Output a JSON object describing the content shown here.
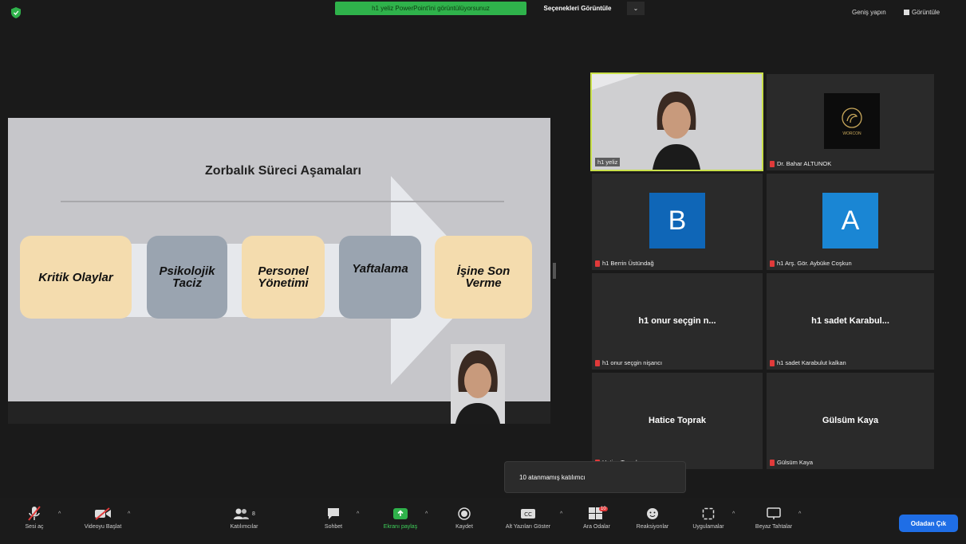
{
  "top_bar": {
    "share_banner": "h1 yeliz PowerPoint'ini görüntülüyorsunuz",
    "view_options": "Seçenekleri Görüntüle",
    "view_options_caret": "⌄",
    "exit_fullscreen": "Geniş yapın",
    "gallery_view": "Görüntüle"
  },
  "slide": {
    "title": "Zorbalık Süreci Aşamaları",
    "stages": [
      {
        "label": "Kritik Olaylar",
        "color": "#f4dcae"
      },
      {
        "label": "Psikolojik\nTaciz",
        "color": "#9aa4b0"
      },
      {
        "label": "Personel\nYönetimi",
        "color": "#f4dcae"
      },
      {
        "label": "Yaftalama",
        "color": "#9aa4b0"
      },
      {
        "label": "İşine Son\nVerme",
        "color": "#f4dcae"
      }
    ]
  },
  "participants": [
    {
      "tile": "h1 yeliz",
      "name": "h1 yeliz",
      "type": "video",
      "active_speaker": true,
      "muted": false
    },
    {
      "tile": "WORCON",
      "name": "Dr. Bahar ALTUNOK",
      "type": "logo",
      "muted": true
    },
    {
      "tile": "B",
      "name": "h1 Berrin Üstündağ",
      "type": "avatar",
      "avatar_color": "#0f66b7",
      "muted": true
    },
    {
      "tile": "A",
      "name": "h1 Arş. Gör. Aybüke Coşkun",
      "type": "avatar",
      "avatar_color": "#1a86d4",
      "muted": true
    },
    {
      "tile": "h1 onur seçgin n...",
      "name": "h1 onur seçgin nişancı",
      "type": "name",
      "muted": true
    },
    {
      "tile": "h1 sadet Karabul...",
      "name": "h1 sadet Karabulut kalkan",
      "type": "name",
      "muted": true
    },
    {
      "tile": "Hatice Toprak",
      "name": "Hatice Toprak",
      "type": "name",
      "muted": true
    },
    {
      "tile": "Gülsüm Kaya",
      "name": "Gülsüm Kaya",
      "type": "name",
      "muted": true
    }
  ],
  "tooltip": "10 atanmamış katılımcı",
  "toolbar": {
    "mute": "Sesi aç",
    "video": "Videoyu Başlat",
    "participants": "Katılımcılar",
    "participants_count": "8",
    "chat": "Sohbet",
    "share": "Ekranı paylaş",
    "record": "Kaydet",
    "captions": "Alt Yazıları Göster",
    "breakout": "Ara Odalar",
    "breakout_badge": "10",
    "reactions": "Reaksiyonlar",
    "apps": "Uygulamalar",
    "whiteboard": "Beyaz Tahtalar",
    "leave": "Odadan Çık"
  },
  "colors": {
    "accent": "#1f6ee6",
    "share_green": "#2fb24b",
    "active_speaker": "#c9e04a",
    "muted_red": "#e03a3a"
  }
}
